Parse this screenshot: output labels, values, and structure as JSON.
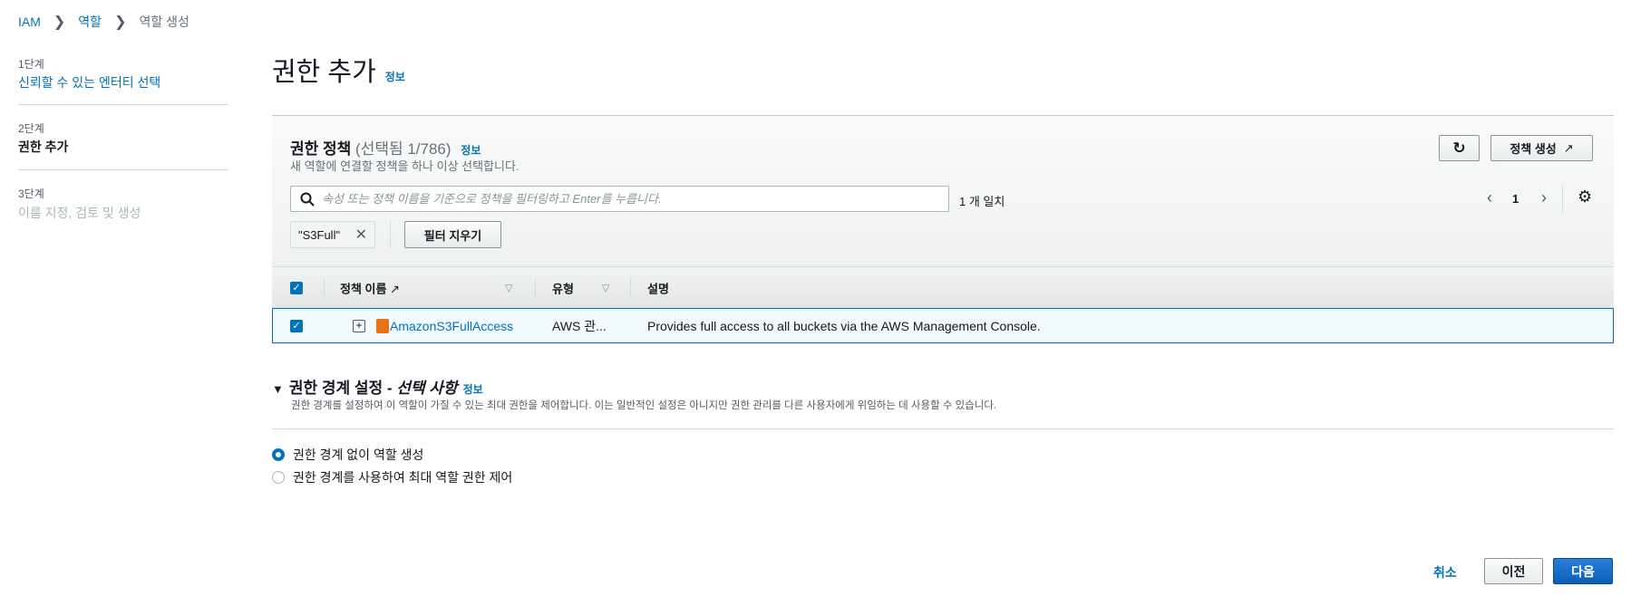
{
  "breadcrumb": [
    "IAM",
    "역할",
    "역할 생성"
  ],
  "steps": [
    {
      "num": "1단계",
      "label": "신뢰할 수 있는 엔터티 선택",
      "state": "link"
    },
    {
      "num": "2단계",
      "label": "권한 추가",
      "state": "current"
    },
    {
      "num": "3단계",
      "label": "이름 지정, 검토 및 생성",
      "state": "disabled"
    }
  ],
  "page": {
    "title": "권한 추가",
    "info": "정보"
  },
  "policies": {
    "title": "권한 정책",
    "count": "(선택됨 1/786)",
    "info": "정보",
    "subtitle": "새 역할에 연결할 정책을 하나 이상 선택합니다.",
    "create_label": "정책 생성",
    "search_placeholder": "속성 또는 정책 이름을 기준으로 정책을 필터링하고 Enter를 누릅니다.",
    "match": "1 개 일치",
    "page": "1",
    "chip": "\"S3Full\"",
    "clear_filters": "필터 지우기",
    "columns": [
      "정책 이름",
      "유형",
      "설명"
    ],
    "rows": [
      {
        "checked": true,
        "name": "AmazonS3FullAccess",
        "type": "AWS 관...",
        "description": "Provides full access to all buckets via the AWS Management Console."
      }
    ]
  },
  "boundary": {
    "title": "권한 경계 설정 - ",
    "title_em": "선택 사항",
    "info": "정보",
    "desc": "권한 경계를 설정하여 이 역할이 가질 수 있는 최대 권한을 제어합니다. 이는 일반적인 설정은 아니지만 권한 관리를 다른 사용자에게 위임하는 데 사용할 수 있습니다.",
    "options": [
      "권한 경계 없이 역할 생성",
      "권한 경계를 사용하여 최대 역할 권한 제어"
    ],
    "selected": 0
  },
  "footer": {
    "cancel": "취소",
    "prev": "이전",
    "next": "다음"
  },
  "colors": {
    "accent": "#0073bb",
    "primary": "#0a6ccf",
    "selected_row": "#f1faff"
  }
}
